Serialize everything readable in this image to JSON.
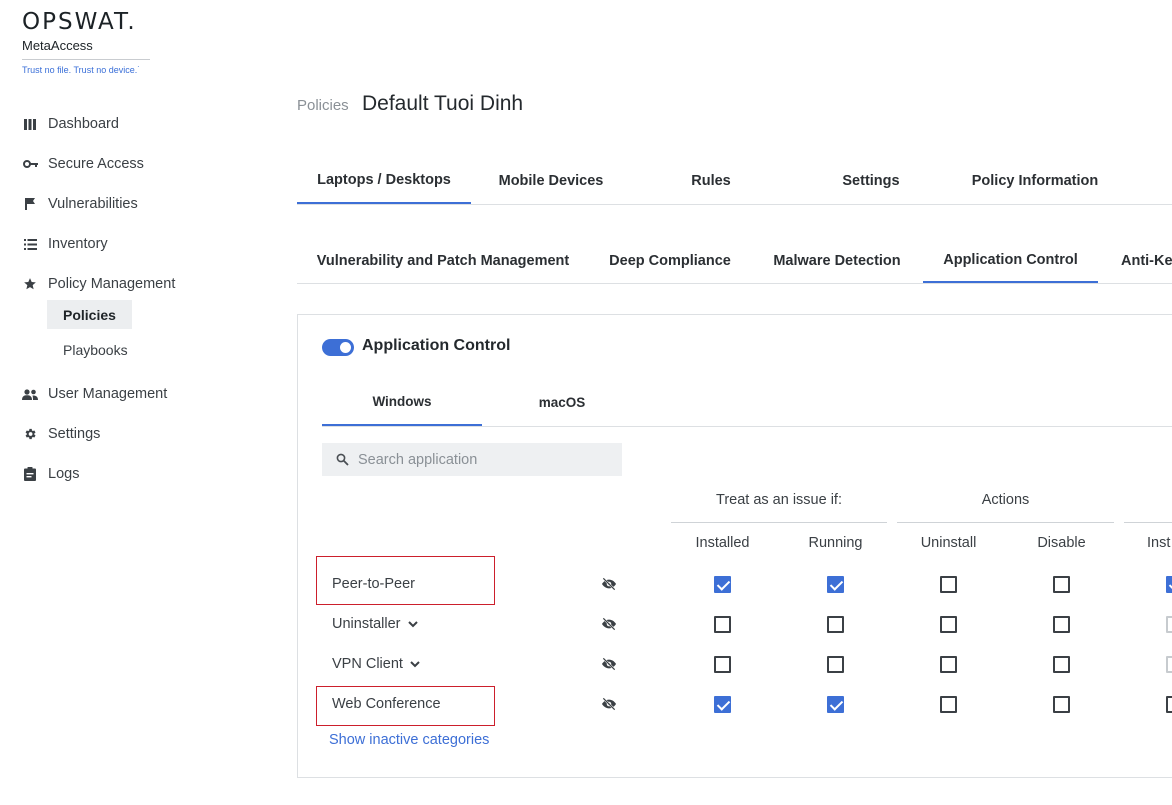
{
  "brand": {
    "name": "OPSWAT.",
    "product": "MetaAccess",
    "tagline": "Trust no file. Trust no device.˙"
  },
  "sidebar": {
    "items": [
      {
        "label": "Dashboard",
        "icon": "bar-chart-icon"
      },
      {
        "label": "Secure Access",
        "icon": "key-icon"
      },
      {
        "label": "Vulnerabilities",
        "icon": "flag-icon"
      },
      {
        "label": "Inventory",
        "icon": "list-icon"
      },
      {
        "label": "Policy Management",
        "icon": "star-icon"
      },
      {
        "label": "User Management",
        "icon": "users-icon"
      },
      {
        "label": "Settings",
        "icon": "gear-icon"
      },
      {
        "label": "Logs",
        "icon": "clipboard-icon"
      }
    ],
    "sub_items": [
      {
        "label": "Policies",
        "active": true
      },
      {
        "label": "Playbooks",
        "active": false
      }
    ]
  },
  "header": {
    "breadcrumb": "Policies",
    "title": "Default Tuoi Dinh"
  },
  "main_tabs": [
    {
      "label": "Laptops / Desktops",
      "active": true
    },
    {
      "label": "Mobile Devices",
      "active": false
    },
    {
      "label": "Rules",
      "active": false
    },
    {
      "label": "Settings",
      "active": false
    },
    {
      "label": "Policy Information",
      "active": false
    }
  ],
  "sub_tabs": [
    {
      "label": "Vulnerability and Patch Management",
      "active": false
    },
    {
      "label": "Deep Compliance",
      "active": false
    },
    {
      "label": "Malware Detection",
      "active": false
    },
    {
      "label": "Application Control",
      "active": true
    },
    {
      "label": "Anti-Ke",
      "active": false
    }
  ],
  "app_control": {
    "toggle_label": "Application Control",
    "enabled": true,
    "os_tabs": [
      {
        "label": "Windows",
        "active": true
      },
      {
        "label": "macOS",
        "active": false
      }
    ],
    "search_placeholder": "Search application",
    "group_headers": [
      "Treat as an issue if:",
      "Actions"
    ],
    "columns": [
      "Installed",
      "Running",
      "Uninstall",
      "Disable",
      "Inst"
    ],
    "rows": [
      {
        "label": "Peer-to-Peer",
        "expandable": false,
        "highlighted": true,
        "checks": [
          true,
          true,
          false,
          false,
          true
        ]
      },
      {
        "label": "Uninstaller",
        "expandable": true,
        "highlighted": false,
        "checks": [
          false,
          false,
          false,
          false,
          false
        ]
      },
      {
        "label": "VPN Client",
        "expandable": true,
        "highlighted": false,
        "checks": [
          false,
          false,
          false,
          false,
          false
        ]
      },
      {
        "label": "Web Conference",
        "expandable": false,
        "highlighted": true,
        "checks": [
          true,
          true,
          false,
          false,
          false
        ]
      }
    ],
    "show_inactive_label": "Show inactive categories"
  },
  "colors": {
    "accent": "#3d6fd6",
    "highlight_border": "#cc1f2c"
  }
}
